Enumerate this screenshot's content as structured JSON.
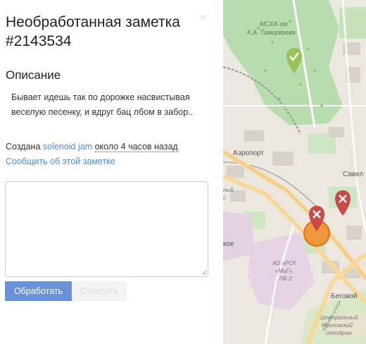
{
  "note": {
    "title": "Необработанная заметка #2143534",
    "close_glyph": "×",
    "section_heading": "Описание",
    "description": "Бывает идешь так по дорожке насвистывая веселую песенку, и вдруг бац лбом в забор..",
    "created_prefix": "Создана",
    "creator": "solenoid jam",
    "created_time": "около 4 часов назад",
    "report_link": "Сообщить об этой заметке",
    "comment_placeholder": "",
    "resolve_button": "Обработать",
    "comment_button": "Ответить"
  },
  "map": {
    "labels": {
      "mskha_1": "МСХА им",
      "mskha_2": "К.А. Тимирязева",
      "airport": "Аэропорт",
      "savel": "Савел",
      "left_1": "ный",
      "left_2": "с",
      "koe": "кое",
      "rsk_1": "АО «РСК",
      "rsk_2": "«МиГ»,",
      "rsk_3": "ПК-2",
      "begov": "Беговой",
      "centr_1": "Центральный",
      "centr_2": "Московский",
      "centr_3": "ипподром",
      "street": "Беговая улица"
    },
    "colors": {
      "park": "#b7dcae",
      "background": "#ece7df",
      "industrial": "#e6d4e4",
      "closed_marker": "#9bc25a",
      "open_marker": "#c94a4a",
      "selected_circle": "#f08a24"
    },
    "markers": [
      {
        "status": "closed",
        "icon": "check"
      },
      {
        "status": "open",
        "icon": "cross"
      },
      {
        "status": "open",
        "icon": "cross"
      }
    ]
  }
}
